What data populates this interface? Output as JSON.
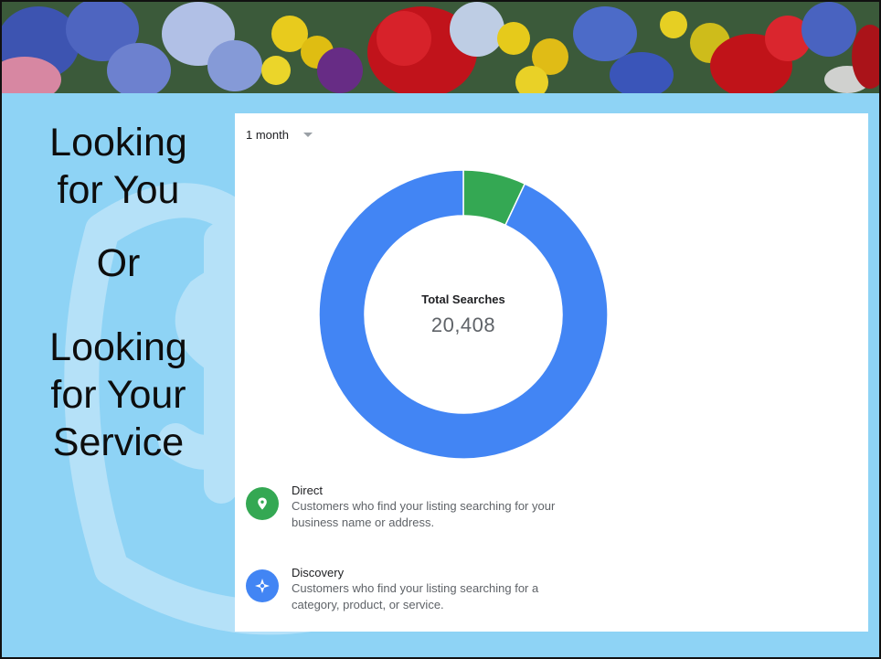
{
  "left_text": {
    "line1": "Looking",
    "line2": "for You",
    "line3": "Or",
    "line4": "Looking",
    "line5": "for Your",
    "line6": "Service"
  },
  "card": {
    "period_label": "1 month",
    "center_label": "Total Searches",
    "center_value": "20,408",
    "legend": [
      {
        "title": "Direct",
        "description": "Customers who find your listing searching for your business name or address.",
        "color": "#34a853",
        "icon": "map-pin-icon"
      },
      {
        "title": "Discovery",
        "description": "Customers who find your listing searching for a category, product, or service.",
        "color": "#4285f4",
        "icon": "compass-icon"
      }
    ]
  },
  "chart_data": {
    "type": "pie",
    "style": "donut",
    "title": "Total Searches",
    "total": 20408,
    "series": [
      {
        "name": "Direct",
        "fraction": 0.07,
        "color": "#34a853"
      },
      {
        "name": "Discovery",
        "fraction": 0.93,
        "color": "#4285f4"
      }
    ]
  }
}
